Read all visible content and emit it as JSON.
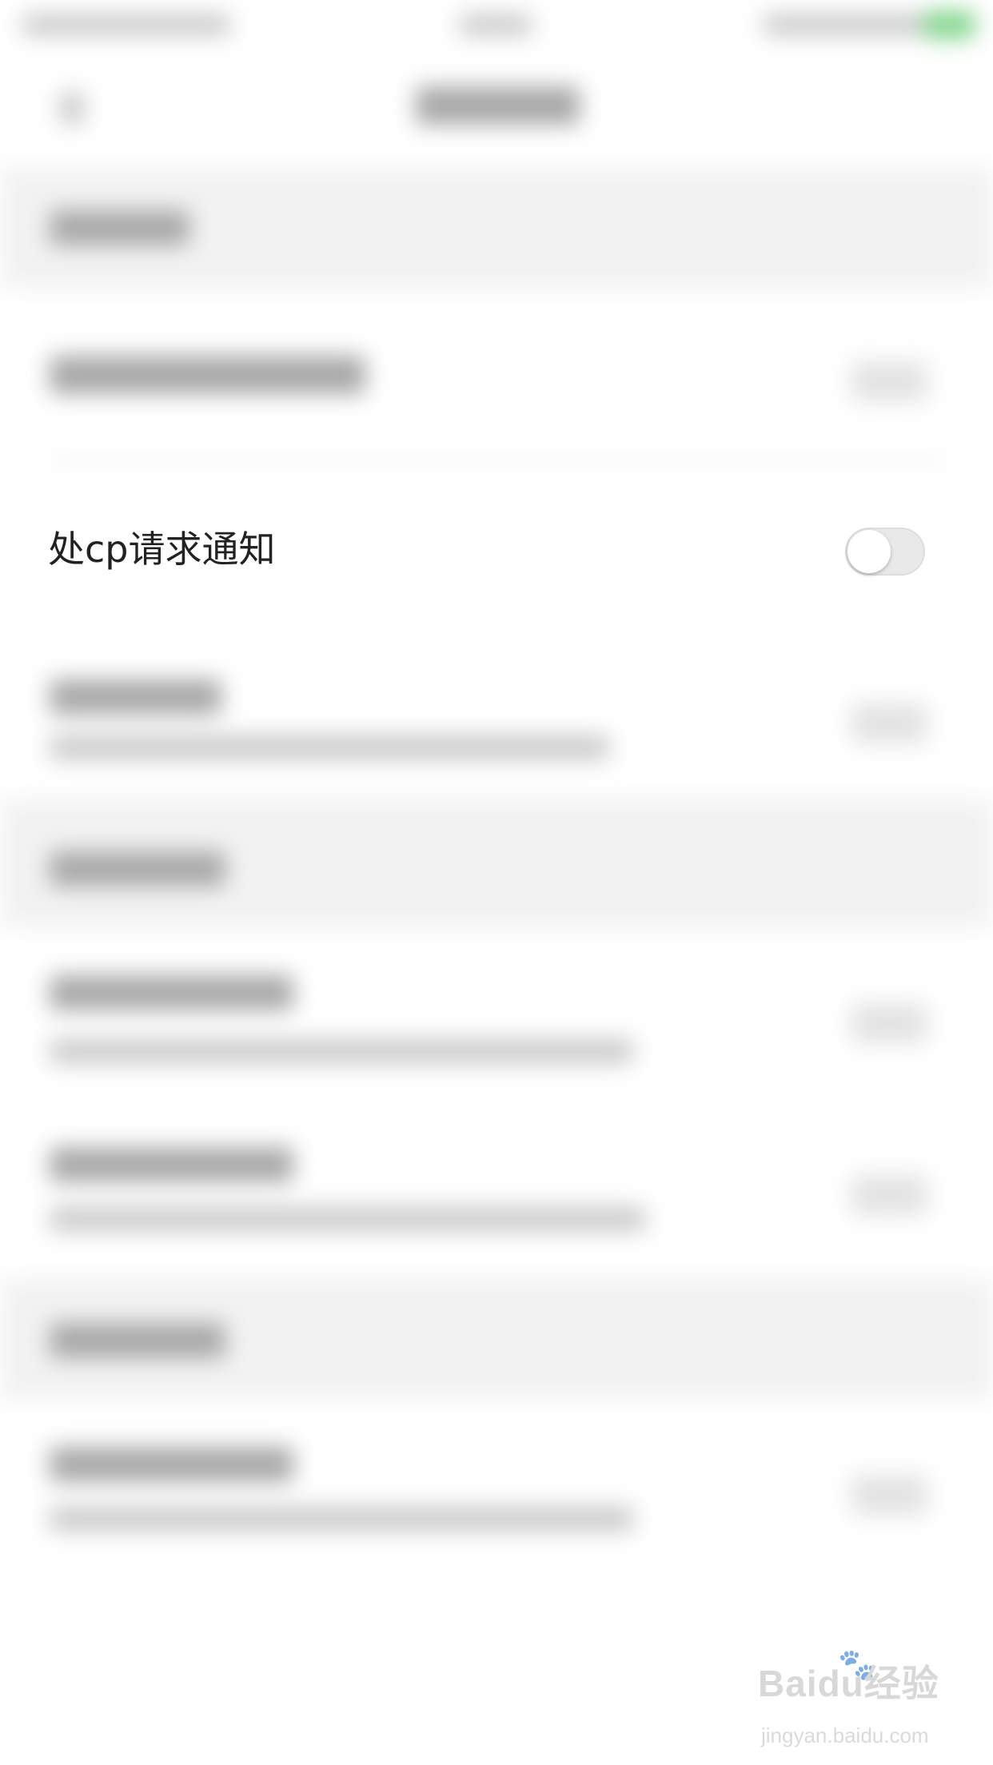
{
  "settings": {
    "cp_request_notification": {
      "label": "处cp请求通知",
      "enabled": false
    }
  },
  "watermark": {
    "brand": "Baidu经验",
    "url": "jingyan.baidu.com",
    "paw_icon": "paw-icon"
  },
  "colors": {
    "toggle_off_track": "#e9e9e9",
    "toggle_knob": "#ffffff",
    "status_battery": "#7fd48a"
  }
}
